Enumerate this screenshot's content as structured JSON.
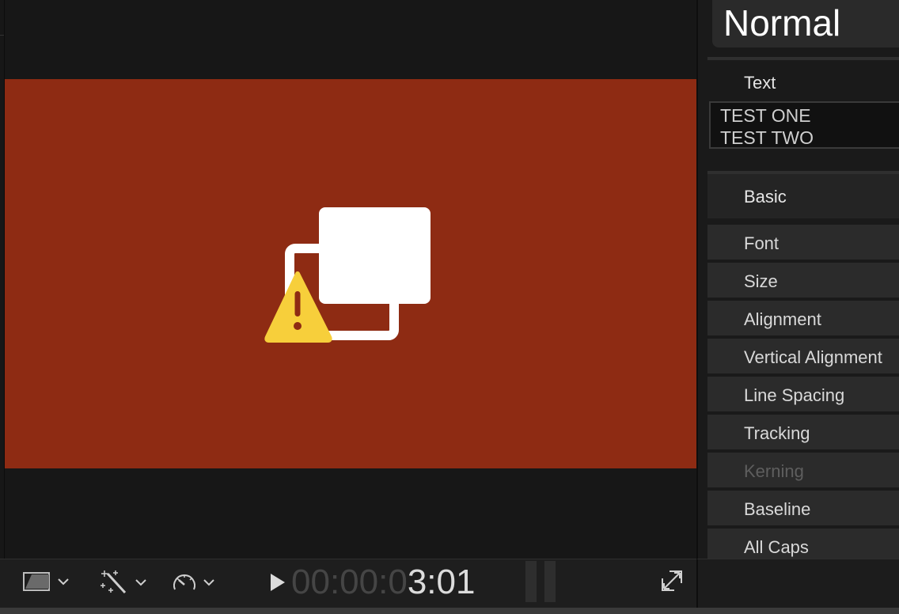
{
  "viewer": {
    "frame_color": "#8e2b13",
    "status_icon": "missing-media-warning-icon"
  },
  "toolbar": {
    "view_menu_icon": "view-options-icon",
    "effects_menu_icon": "magic-wand-icon",
    "speed_menu_icon": "speedometer-icon",
    "play_icon": "play-icon",
    "timecode_dim": "00:00:0",
    "timecode_lit": "3:01",
    "fullscreen_icon": "fullscreen-icon"
  },
  "inspector": {
    "preset": "Normal",
    "text_section": "Text",
    "text_lines": [
      "TEST ONE",
      "TEST TWO"
    ],
    "basic_section": "Basic",
    "properties": [
      {
        "label": "Font",
        "enabled": true
      },
      {
        "label": "Size",
        "enabled": true
      },
      {
        "label": "Alignment",
        "enabled": true
      },
      {
        "label": "Vertical Alignment",
        "enabled": true
      },
      {
        "label": "Line Spacing",
        "enabled": true
      },
      {
        "label": "Tracking",
        "enabled": true
      },
      {
        "label": "Kerning",
        "enabled": false
      },
      {
        "label": "Baseline",
        "enabled": true
      },
      {
        "label": "All Caps",
        "enabled": true
      }
    ]
  }
}
